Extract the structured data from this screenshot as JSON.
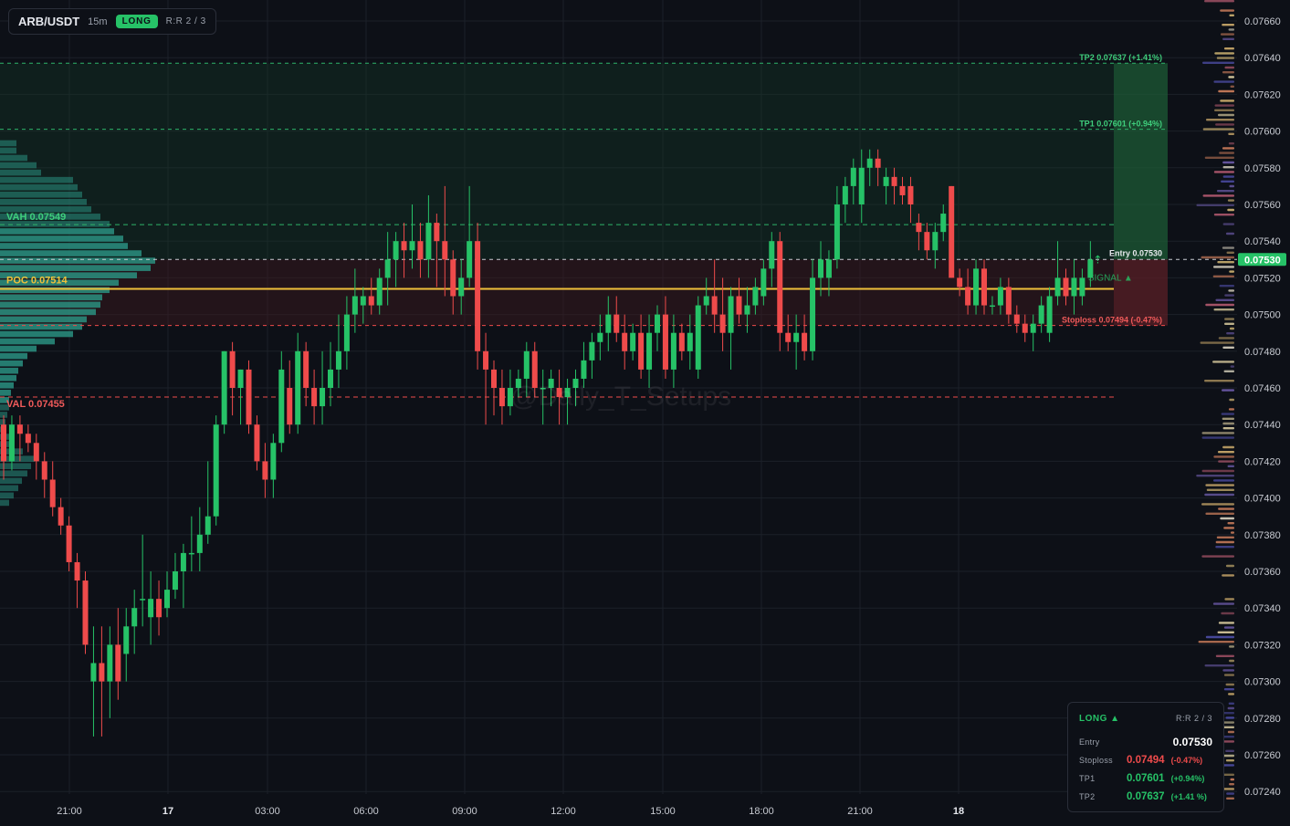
{
  "header": {
    "symbol": "ARB/USDT",
    "timeframe": "15m",
    "direction": "LONG",
    "rr": "R:R 2 / 3"
  },
  "colors": {
    "up": "#26c267",
    "down": "#ef4b4b",
    "poc": "#f0c13a",
    "bg": "#0d1017",
    "grid": "#1c2029",
    "profile": "#2a8f80",
    "tp_zone": "#153d27",
    "sl_zone": "#3d1a1f"
  },
  "levels": {
    "tp2": {
      "label": "TP2 0.07637 (+1.41%)",
      "value": 0.07637
    },
    "tp1": {
      "label": "TP1 0.07601 (+0.94%)",
      "value": 0.07601
    },
    "vah": {
      "label": "VAH  0.07549",
      "value": 0.07549
    },
    "entry": {
      "label": "Entry 0.07530",
      "value": 0.0753
    },
    "poc": {
      "label": "POC  0.07514",
      "value": 0.07514
    },
    "stoploss": {
      "label": "Stoploss 0.07494 (-0.47%)",
      "value": 0.07494
    },
    "val": {
      "label": "VAL  0.07455",
      "value": 0.07455
    }
  },
  "price_axis": {
    "ticks": [
      "0.07660",
      "0.07640",
      "0.07620",
      "0.07600",
      "0.07580",
      "0.07560",
      "0.07540",
      "0.07520",
      "0.07500",
      "0.07480",
      "0.07460",
      "0.07440",
      "0.07420",
      "0.07400",
      "0.07380",
      "0.07360",
      "0.07340",
      "0.07320",
      "0.07300",
      "0.07280",
      "0.07260",
      "0.07240"
    ],
    "current_price": "0.07530"
  },
  "time_axis": [
    "21:00",
    "17",
    "03:00",
    "06:00",
    "09:00",
    "12:00",
    "15:00",
    "18:00",
    "21:00",
    "18"
  ],
  "signal_label": "SIGNAL ▲",
  "watermark": "@Daily_T_Setups",
  "panel": {
    "direction": "LONG ▲",
    "rr": "R:R 2 / 3",
    "entry_label": "Entry",
    "entry_value": "0.07530",
    "sl_label": "Stoploss",
    "sl_value": "0.07494",
    "sl_pct": "(-0.47%)",
    "tp1_label": "TP1",
    "tp1_value": "0.07601",
    "tp1_pct": "(+0.94%)",
    "tp2_label": "TP2",
    "tp2_value": "0.07637",
    "tp2_pct": "(+1.41 %)"
  },
  "chart_data": {
    "type": "candlestick",
    "title": "ARB/USDT 15m",
    "ylim": [
      0.0723,
      0.0767
    ],
    "candles": [
      [
        0.0744,
        0.07445,
        0.0741,
        0.0742
      ],
      [
        0.0742,
        0.07445,
        0.07415,
        0.0744
      ],
      [
        0.0744,
        0.07445,
        0.0742,
        0.07435
      ],
      [
        0.07435,
        0.0744,
        0.07425,
        0.0743
      ],
      [
        0.0743,
        0.07435,
        0.0741,
        0.0742
      ],
      [
        0.0742,
        0.07425,
        0.074,
        0.0741
      ],
      [
        0.0741,
        0.0742,
        0.0739,
        0.07395
      ],
      [
        0.07395,
        0.074,
        0.0738,
        0.07385
      ],
      [
        0.07385,
        0.0739,
        0.0736,
        0.07365
      ],
      [
        0.07365,
        0.0737,
        0.0734,
        0.07355
      ],
      [
        0.07355,
        0.0736,
        0.07315,
        0.0732
      ],
      [
        0.073,
        0.0733,
        0.0727,
        0.0731
      ],
      [
        0.0731,
        0.0733,
        0.0727,
        0.073
      ],
      [
        0.073,
        0.0733,
        0.0728,
        0.0732
      ],
      [
        0.0732,
        0.0734,
        0.0729,
        0.073
      ],
      [
        0.07315,
        0.0734,
        0.073,
        0.0733
      ],
      [
        0.0733,
        0.0735,
        0.07315,
        0.0734
      ],
      [
        0.07345,
        0.0738,
        0.0733,
        0.07345
      ],
      [
        0.07335,
        0.0736,
        0.0732,
        0.07345
      ],
      [
        0.07345,
        0.07355,
        0.07325,
        0.07335
      ],
      [
        0.0734,
        0.0736,
        0.07335,
        0.0735
      ],
      [
        0.0735,
        0.0737,
        0.07345,
        0.0736
      ],
      [
        0.0736,
        0.07375,
        0.0734,
        0.0737
      ],
      [
        0.0737,
        0.0739,
        0.0736,
        0.0737
      ],
      [
        0.0737,
        0.07395,
        0.0736,
        0.0738
      ],
      [
        0.0738,
        0.0742,
        0.07375,
        0.0739
      ],
      [
        0.0739,
        0.07445,
        0.07385,
        0.0744
      ],
      [
        0.0744,
        0.0748,
        0.07435,
        0.0748
      ],
      [
        0.0748,
        0.07485,
        0.07445,
        0.0746
      ],
      [
        0.0746,
        0.0747,
        0.0744,
        0.0747
      ],
      [
        0.0747,
        0.07475,
        0.07435,
        0.0744
      ],
      [
        0.0744,
        0.07445,
        0.07415,
        0.0742
      ],
      [
        0.0742,
        0.0743,
        0.074,
        0.0741
      ],
      [
        0.0741,
        0.07435,
        0.074,
        0.0743
      ],
      [
        0.0743,
        0.0748,
        0.07425,
        0.0747
      ],
      [
        0.0746,
        0.07475,
        0.07435,
        0.0744
      ],
      [
        0.0744,
        0.0749,
        0.07435,
        0.0748
      ],
      [
        0.0748,
        0.07485,
        0.0745,
        0.0746
      ],
      [
        0.0746,
        0.0747,
        0.0744,
        0.0745
      ],
      [
        0.0745,
        0.0748,
        0.0744,
        0.0746
      ],
      [
        0.0746,
        0.07485,
        0.0745,
        0.0747
      ],
      [
        0.0747,
        0.075,
        0.0746,
        0.0748
      ],
      [
        0.0748,
        0.0751,
        0.0747,
        0.075
      ],
      [
        0.075,
        0.07525,
        0.0749,
        0.0751
      ],
      [
        0.07505,
        0.07515,
        0.07495,
        0.0751
      ],
      [
        0.0751,
        0.0752,
        0.075,
        0.07505
      ],
      [
        0.07505,
        0.07525,
        0.075,
        0.0752
      ],
      [
        0.0752,
        0.07545,
        0.07505,
        0.0753
      ],
      [
        0.0753,
        0.07545,
        0.07515,
        0.0754
      ],
      [
        0.0754,
        0.0755,
        0.0752,
        0.07535
      ],
      [
        0.07535,
        0.0756,
        0.07525,
        0.0754
      ],
      [
        0.0754,
        0.0755,
        0.0752,
        0.0753
      ],
      [
        0.0753,
        0.07565,
        0.0752,
        0.0755
      ],
      [
        0.0755,
        0.07555,
        0.07515,
        0.0754
      ],
      [
        0.0754,
        0.0757,
        0.0751,
        0.0753
      ],
      [
        0.0753,
        0.07535,
        0.075,
        0.0751
      ],
      [
        0.0751,
        0.0753,
        0.075,
        0.0752
      ],
      [
        0.0752,
        0.0757,
        0.07515,
        0.0754
      ],
      [
        0.0754,
        0.0755,
        0.0747,
        0.0748
      ],
      [
        0.0748,
        0.0749,
        0.0744,
        0.0747
      ],
      [
        0.0747,
        0.07475,
        0.07445,
        0.0746
      ],
      [
        0.0746,
        0.0747,
        0.0744,
        0.0745
      ],
      [
        0.0745,
        0.0747,
        0.07445,
        0.0746
      ],
      [
        0.0746,
        0.0747,
        0.07455,
        0.07465
      ],
      [
        0.07465,
        0.07485,
        0.07455,
        0.0748
      ],
      [
        0.0748,
        0.07485,
        0.07455,
        0.0746
      ],
      [
        0.0746,
        0.0747,
        0.0744,
        0.0746
      ],
      [
        0.0746,
        0.0747,
        0.0745,
        0.07465
      ],
      [
        0.0746,
        0.0747,
        0.0744,
        0.07455
      ],
      [
        0.07455,
        0.07465,
        0.0744,
        0.0746
      ],
      [
        0.0746,
        0.0747,
        0.0745,
        0.07465
      ],
      [
        0.07465,
        0.07485,
        0.0746,
        0.07475
      ],
      [
        0.07475,
        0.0749,
        0.07465,
        0.07485
      ],
      [
        0.07485,
        0.075,
        0.07475,
        0.0749
      ],
      [
        0.0749,
        0.0751,
        0.0748,
        0.075
      ],
      [
        0.075,
        0.0751,
        0.07485,
        0.0749
      ],
      [
        0.0749,
        0.075,
        0.0747,
        0.0748
      ],
      [
        0.0748,
        0.07495,
        0.07475,
        0.0749
      ],
      [
        0.0749,
        0.075,
        0.07465,
        0.0747
      ],
      [
        0.0747,
        0.075,
        0.0746,
        0.0749
      ],
      [
        0.0749,
        0.07505,
        0.0748,
        0.075
      ],
      [
        0.075,
        0.0751,
        0.07465,
        0.0747
      ],
      [
        0.0747,
        0.075,
        0.0746,
        0.0749
      ],
      [
        0.0749,
        0.07495,
        0.07475,
        0.0748
      ],
      [
        0.0748,
        0.075,
        0.0747,
        0.0749
      ],
      [
        0.0747,
        0.0751,
        0.07465,
        0.07505
      ],
      [
        0.07505,
        0.0752,
        0.075,
        0.0751
      ],
      [
        0.0751,
        0.0753,
        0.0749,
        0.075
      ],
      [
        0.075,
        0.0752,
        0.0748,
        0.0749
      ],
      [
        0.0749,
        0.07515,
        0.0747,
        0.0751
      ],
      [
        0.0751,
        0.0752,
        0.07495,
        0.075
      ],
      [
        0.075,
        0.07515,
        0.0749,
        0.07505
      ],
      [
        0.07505,
        0.0752,
        0.075,
        0.07515
      ],
      [
        0.0751,
        0.0753,
        0.07505,
        0.07525
      ],
      [
        0.07525,
        0.07545,
        0.07515,
        0.0754
      ],
      [
        0.0754,
        0.07545,
        0.0748,
        0.0749
      ],
      [
        0.0749,
        0.075,
        0.0748,
        0.07485
      ],
      [
        0.07485,
        0.075,
        0.0747,
        0.0749
      ],
      [
        0.0749,
        0.075,
        0.07475,
        0.0748
      ],
      [
        0.0748,
        0.0753,
        0.07475,
        0.0752
      ],
      [
        0.0752,
        0.0754,
        0.0751,
        0.0753
      ],
      [
        0.0752,
        0.07535,
        0.0751,
        0.0753
      ],
      [
        0.0753,
        0.0757,
        0.07525,
        0.0756
      ],
      [
        0.0756,
        0.07575,
        0.0755,
        0.0757
      ],
      [
        0.0757,
        0.07585,
        0.0756,
        0.0758
      ],
      [
        0.0756,
        0.0759,
        0.0755,
        0.0758
      ],
      [
        0.0758,
        0.0759,
        0.0757,
        0.07585
      ],
      [
        0.07585,
        0.0759,
        0.0757,
        0.0758
      ],
      [
        0.0757,
        0.0758,
        0.0756,
        0.07575
      ],
      [
        0.07575,
        0.0758,
        0.0756,
        0.0757
      ],
      [
        0.0757,
        0.07575,
        0.0756,
        0.07565
      ],
      [
        0.0757,
        0.07575,
        0.0755,
        0.0756
      ],
      [
        0.0755,
        0.07555,
        0.07535,
        0.07545
      ],
      [
        0.07545,
        0.0755,
        0.0753,
        0.07535
      ],
      [
        0.07535,
        0.0755,
        0.07525,
        0.07545
      ],
      [
        0.07545,
        0.0756,
        0.0754,
        0.07555
      ],
      [
        0.0757,
        0.0757,
        0.0752,
        0.0752
      ],
      [
        0.0752,
        0.07525,
        0.0751,
        0.07515
      ],
      [
        0.07515,
        0.07525,
        0.075,
        0.07505
      ],
      [
        0.07505,
        0.0753,
        0.075,
        0.07525
      ],
      [
        0.07525,
        0.0753,
        0.075,
        0.07505
      ],
      [
        0.07505,
        0.0751,
        0.075,
        0.07505
      ],
      [
        0.07505,
        0.0752,
        0.075,
        0.07515
      ],
      [
        0.07515,
        0.0752,
        0.07495,
        0.075
      ],
      [
        0.075,
        0.07505,
        0.0749,
        0.07495
      ],
      [
        0.07495,
        0.075,
        0.07485,
        0.0749
      ],
      [
        0.0749,
        0.075,
        0.0748,
        0.07495
      ],
      [
        0.07495,
        0.0751,
        0.0749,
        0.07505
      ],
      [
        0.0749,
        0.07515,
        0.07485,
        0.0751
      ],
      [
        0.0751,
        0.0754,
        0.07505,
        0.0752
      ],
      [
        0.0752,
        0.07525,
        0.07505,
        0.0751
      ],
      [
        0.0751,
        0.0753,
        0.075,
        0.0752
      ],
      [
        0.0751,
        0.07525,
        0.07505,
        0.0752
      ],
      [
        0.0752,
        0.0754,
        0.07515,
        0.0753
      ]
    ]
  }
}
